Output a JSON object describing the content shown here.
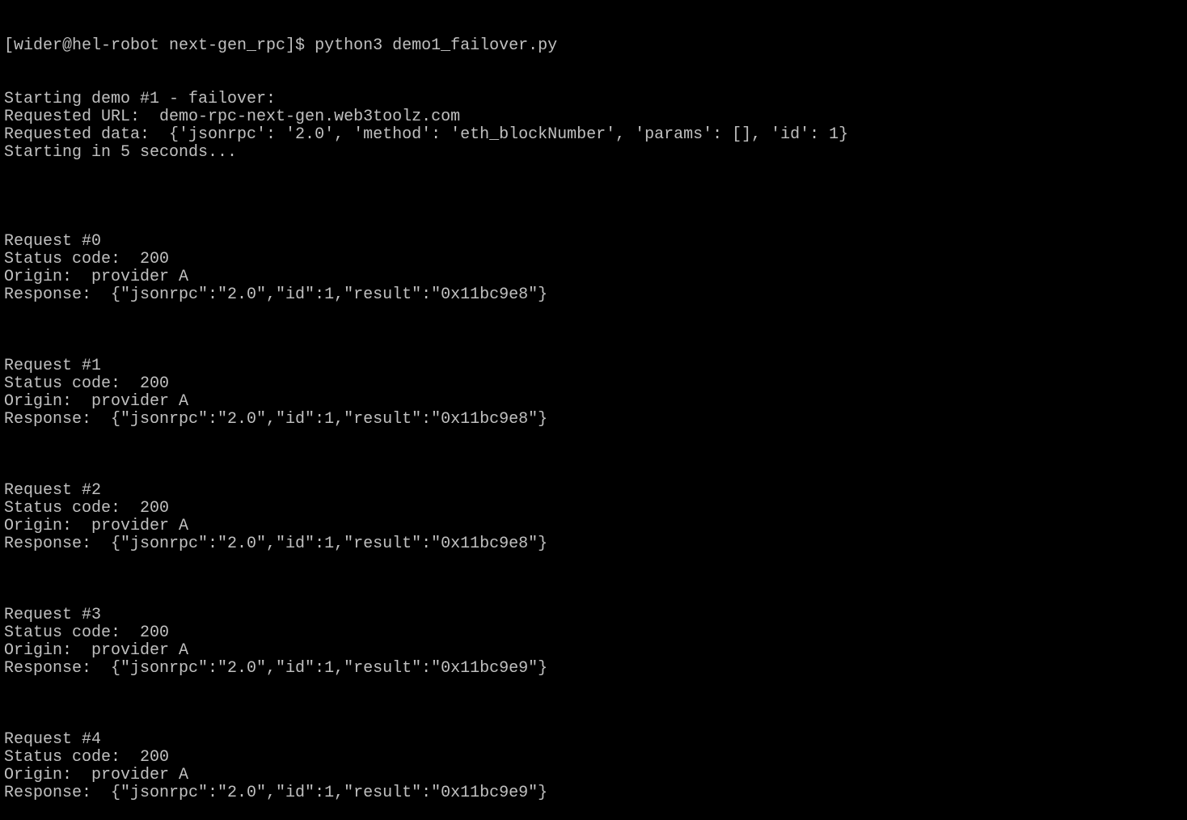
{
  "terminal": {
    "prompt": "[wider@hel-robot next-gen_rpc]$ python3 demo1_failover.py",
    "header_lines": [
      "Starting demo #1 - failover:",
      "Requested URL:  demo-rpc-next-gen.web3toolz.com",
      "Requested data:  {'jsonrpc': '2.0', 'method': 'eth_blockNumber', 'params': [], 'id': 1}",
      "Starting in 5 seconds..."
    ],
    "requests": [
      {
        "title": "Request #0",
        "status": "Status code:  200",
        "origin": "Origin:  provider A",
        "response": "Response:  {\"jsonrpc\":\"2.0\",\"id\":1,\"result\":\"0x11bc9e8\"}"
      },
      {
        "title": "Request #1",
        "status": "Status code:  200",
        "origin": "Origin:  provider A",
        "response": "Response:  {\"jsonrpc\":\"2.0\",\"id\":1,\"result\":\"0x11bc9e8\"}"
      },
      {
        "title": "Request #2",
        "status": "Status code:  200",
        "origin": "Origin:  provider A",
        "response": "Response:  {\"jsonrpc\":\"2.0\",\"id\":1,\"result\":\"0x11bc9e8\"}"
      },
      {
        "title": "Request #3",
        "status": "Status code:  200",
        "origin": "Origin:  provider A",
        "response": "Response:  {\"jsonrpc\":\"2.0\",\"id\":1,\"result\":\"0x11bc9e9\"}"
      },
      {
        "title": "Request #4",
        "status": "Status code:  200",
        "origin": "Origin:  provider A",
        "response": "Response:  {\"jsonrpc\":\"2.0\",\"id\":1,\"result\":\"0x11bc9e9\"}"
      }
    ],
    "colors": {
      "background": "#000000",
      "text": "#c0c0c0"
    }
  }
}
